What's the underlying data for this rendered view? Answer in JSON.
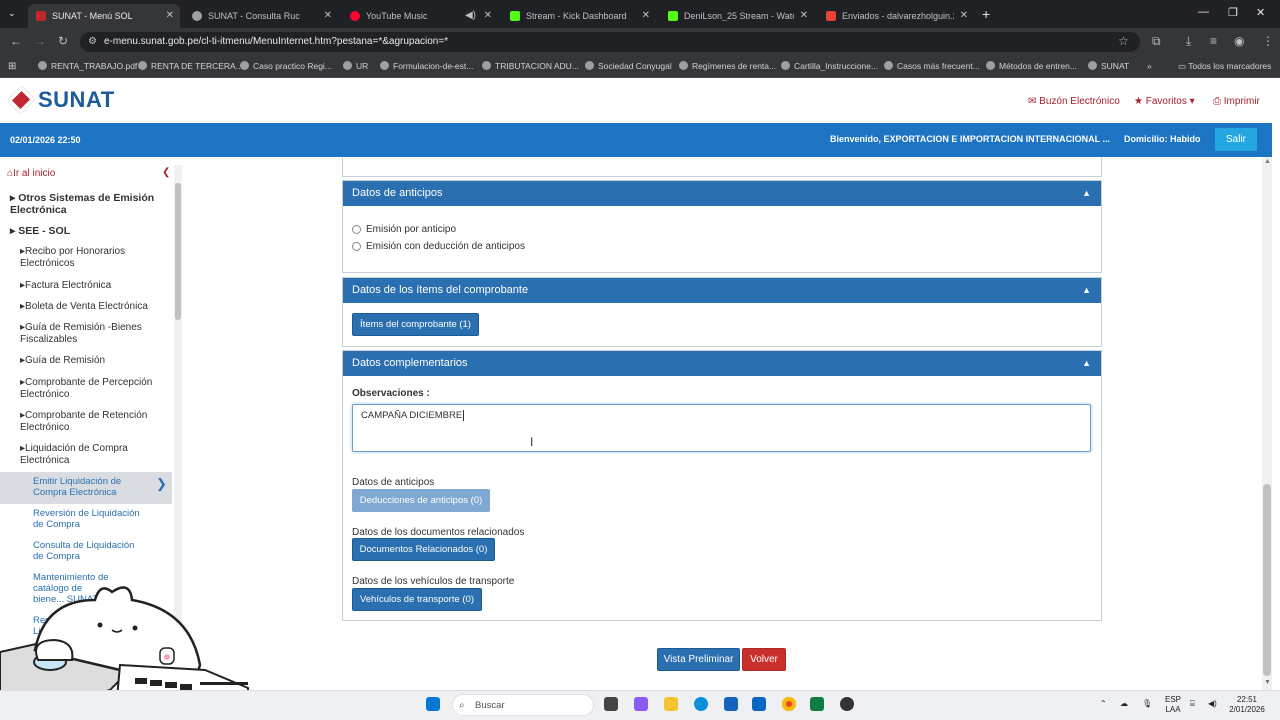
{
  "browser": {
    "tabs": [
      {
        "title": "SUNAT - Menú SOL",
        "active": true,
        "color": "#c2262f"
      },
      {
        "title": "SUNAT - Consulta Ruc",
        "active": false,
        "color": "#9aa0a6"
      },
      {
        "title": "YouTube Music",
        "active": false,
        "color": "#ff0033"
      },
      {
        "title": "Stream - Kick Dashboard",
        "active": false,
        "color": "#53fc18"
      },
      {
        "title": "DeniLson_25 Stream - Watch Li",
        "active": false,
        "color": "#53fc18"
      },
      {
        "title": "Enviados - dalvarezholguin.25@",
        "active": false,
        "color": "#ea4335"
      }
    ],
    "url": "e-menu.sunat.gob.pe/cl-ti-itmenu/MenuInternet.htm?pestana=*&agrupacion=*",
    "bookmarks": [
      "RENTA_TRABAJO.pdf",
      "RENTA DE TERCERA...",
      "Caso practico Regi...",
      "UR",
      "Formulacion-de-est...",
      "TRIBUTACION ADU...",
      "Sociedad Conyugal",
      "Regímenes de renta...",
      "Cartilla_Instruccione...",
      "Casos más frecuent...",
      "Métodos de entren...",
      "SUNAT"
    ],
    "all_bookmarks": "Todos los marcadores"
  },
  "header": {
    "logo_text": "SUNAT",
    "buzon": "Buzón Electrónico",
    "favoritos": "Favoritos",
    "imprimir": "Imprimir"
  },
  "bluebar": {
    "datetime": "02/01/2026 22:50",
    "welcome": "Bienvenido, EXPORTACION E IMPORTACION INTERNACIONAL ...",
    "domicilio": "Domicilio: Habido",
    "salir": "Salir"
  },
  "sidebar": {
    "home": "Ir al inicio",
    "items": [
      "Otros Sistemas de Emisión Electrónica",
      "SEE - SOL",
      "Recibo por Honorarios Electrónicos",
      "Factura Electrónica",
      "Boleta de Venta Electrónica",
      "Guía de Remisión -Bienes Fiscalizables",
      "Guía de Remisión",
      "Comprobante de Percepción Electrónico",
      "Comprobante de Retención Electrónico",
      "Liquidación de Compra Electrónica"
    ],
    "subitems": [
      "Emitir Liquidación de Compra Electrónica",
      "Reversión de Liquidación de Compra",
      "Consulta de Liquidación de Compra",
      "Mantenimiento de catálogo de biene... SUNAT",
      "Registr... Liqui..."
    ]
  },
  "main": {
    "anticipos_title": "Datos de anticipos",
    "radio1": "Emisión por anticipo",
    "radio2": "Emisión con deducción de anticipos",
    "items_title": "Datos de los ítems del comprobante",
    "items_button": "Ítems del comprobante (1)",
    "comp_title": "Datos complementarios",
    "obs_label": "Observaciones :",
    "obs_value": "CAMPAÑA DICIEMBRE",
    "anticipos_label": "Datos de anticipos",
    "deducciones_button": "Deducciones de anticipos (0)",
    "docs_label": "Datos de los documentos relacionados",
    "docs_button": "Documentos Relacionados (0)",
    "veh_label": "Datos de los vehículos de transporte",
    "veh_button": "Vehículos de transporte (0)",
    "preview_button": "Vista Preliminar",
    "back_button": "Volver"
  },
  "taskbar": {
    "search": "Buscar",
    "lang1": "ESP",
    "lang2": "LAA",
    "time": "22:51",
    "date": "2/01/2026"
  },
  "colors": {
    "blue": "#1d74c2",
    "panel": "#2a6fb0",
    "red": "#c2262f"
  }
}
